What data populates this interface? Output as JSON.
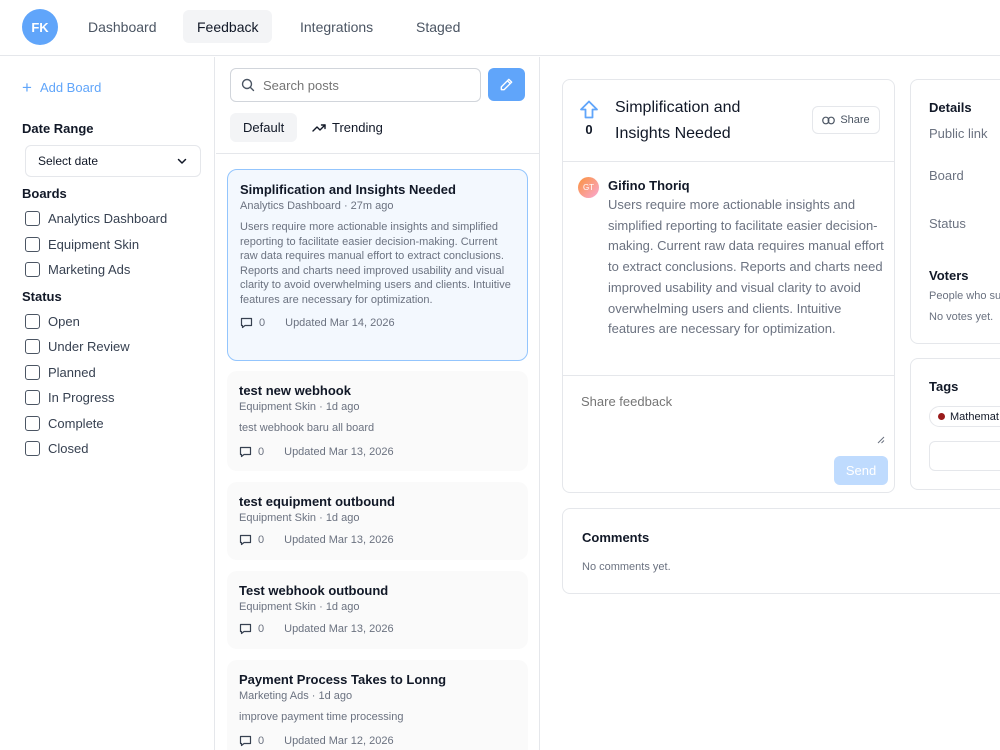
{
  "nav": {
    "avatar_initials": "FK",
    "tabs": [
      {
        "label": "Dashboard"
      },
      {
        "label": "Feedback"
      },
      {
        "label": "Integrations"
      },
      {
        "label": "Staged"
      }
    ],
    "active_tab": "Feedback"
  },
  "sidebar": {
    "add_board": "Add Board",
    "date_range_title": "Date Range",
    "date_select": "Select date",
    "boards_title": "Boards",
    "boards": [
      {
        "label": "Analytics Dashboard",
        "checked": false
      },
      {
        "label": "Equipment Skin",
        "checked": false
      },
      {
        "label": "Marketing Ads",
        "checked": false
      }
    ],
    "status_title": "Status",
    "statuses": [
      {
        "label": "Open",
        "checked": false
      },
      {
        "label": "Under Review",
        "checked": false
      },
      {
        "label": "Planned",
        "checked": false
      },
      {
        "label": "In Progress",
        "checked": false
      },
      {
        "label": "Complete",
        "checked": false
      },
      {
        "label": "Closed",
        "checked": false
      }
    ]
  },
  "list": {
    "search_placeholder": "Search posts",
    "sort_default": "Default",
    "sort_trending": "Trending",
    "posts": [
      {
        "title": "Simplification and Insights Needed",
        "meta": "Analytics Dashboard · 27m ago",
        "body": "Users require more actionable insights and simplified reporting to facilitate easier decision-making. Current raw data requires manual effort to extract conclusions. Reports and charts need improved usability and visual clarity to avoid overwhelming users and clients. Intuitive features are necessary for optimization.",
        "comments": "0",
        "updated": "Updated Mar 14, 2026",
        "selected": true
      },
      {
        "title": "test new webhook",
        "meta": "Equipment Skin · 1d ago",
        "body": "test webhook baru all board",
        "comments": "0",
        "updated": "Updated Mar 13, 2026",
        "selected": false
      },
      {
        "title": "test equipment outbound",
        "meta": "Equipment Skin · 1d ago",
        "body": "",
        "comments": "0",
        "updated": "Updated Mar 13, 2026",
        "selected": false
      },
      {
        "title": "Test webhook outbound",
        "meta": "Equipment Skin · 1d ago",
        "body": "",
        "comments": "0",
        "updated": "Updated Mar 13, 2026",
        "selected": false
      },
      {
        "title": "Payment Process Takes to Lonng",
        "meta": "Marketing Ads · 1d ago",
        "body": "improve payment time processing",
        "comments": "0",
        "updated": "Updated Mar 12, 2026",
        "selected": false
      }
    ]
  },
  "detail": {
    "vote_count": "0",
    "title": "Simplification and Insights Needed",
    "share_label": "Share",
    "author_initials": "GT",
    "author_name": "Gifino Thoriq",
    "body": "Users require more actionable insights and simplified reporting to facilitate easier decision-making. Current raw data requires manual effort to extract conclusions. Reports and charts need improved usability and visual clarity to avoid overwhelming users and clients. Intuitive features are necessary for optimization.",
    "feedback_placeholder": "Share feedback",
    "send_label": "Send"
  },
  "comments": {
    "title": "Comments",
    "empty": "No comments yet."
  },
  "details_panel": {
    "title": "Details",
    "public_link": "Public link",
    "board": "Board",
    "status": "Status",
    "voters_title": "Voters",
    "voters_desc": "People who su",
    "no_votes": "No votes yet."
  },
  "tags_panel": {
    "title": "Tags",
    "tag": "Mathemat",
    "tag_color": "#991b1b"
  },
  "colors": {
    "accent": "#60a5fa",
    "accent_light": "#bfdbfe"
  }
}
